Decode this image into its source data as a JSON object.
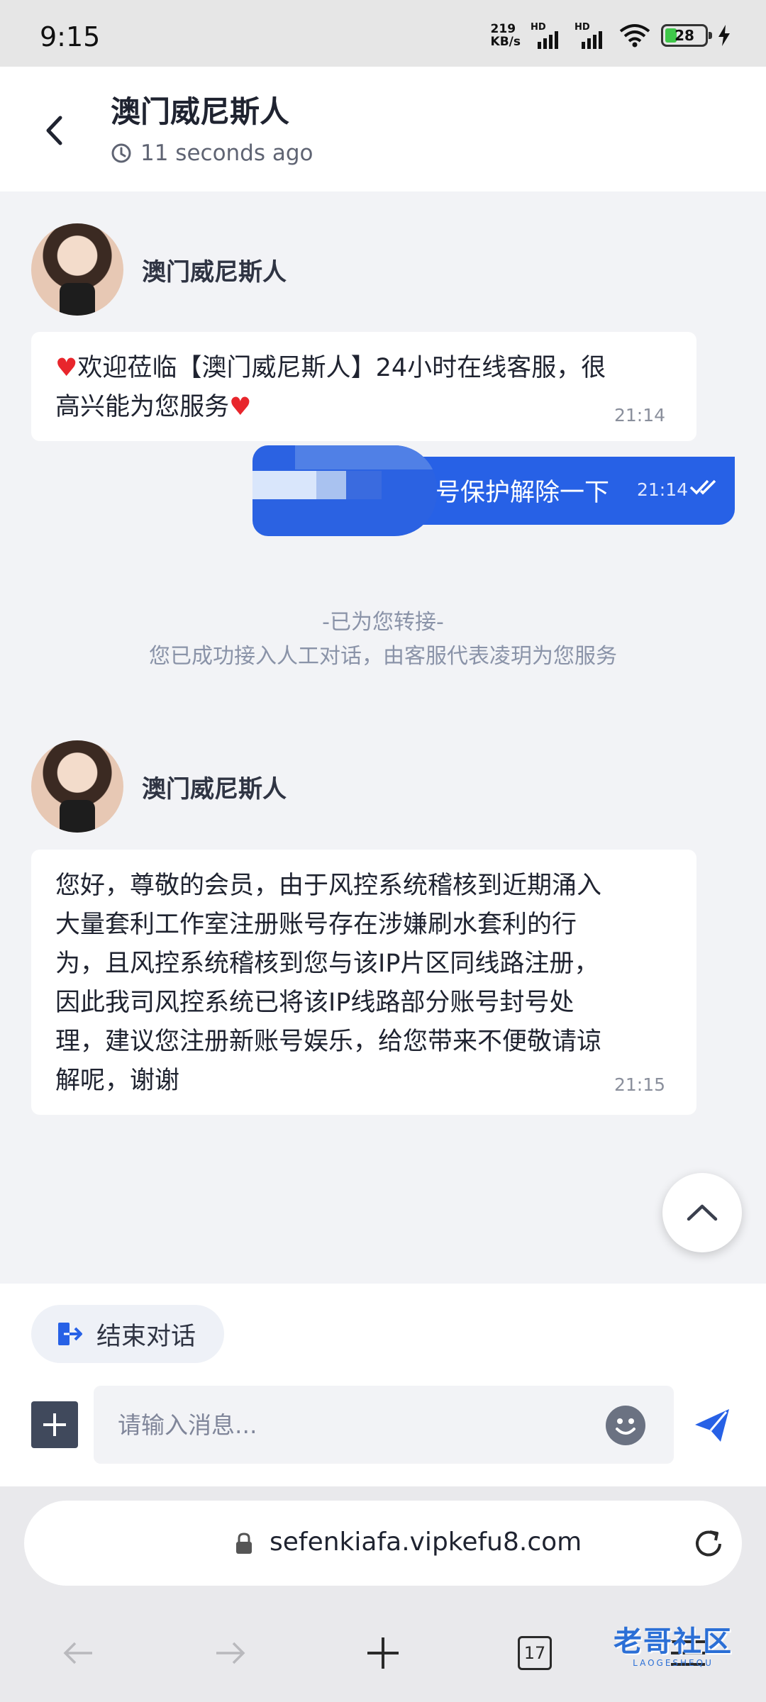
{
  "status_bar": {
    "time": "9:15",
    "net_speed_value": "219",
    "net_speed_unit": "KB/s",
    "sim1_label": "HD",
    "sim2_label": "HD",
    "battery": "28"
  },
  "header": {
    "title": "澳门威尼斯人",
    "last_seen": "11 seconds ago"
  },
  "messages": {
    "agent_name_1": "澳门威尼斯人",
    "welcome_text": "♥欢迎莅临【澳门威尼斯人】24小时在线客服，很高兴能为您服务♥",
    "welcome_time": "21:14",
    "user_text": "号保护解除一下",
    "user_time": "21:14",
    "system_line1": "-已为您转接-",
    "system_line2": "您已成功接入人工对话，由客服代表凌玥为您服务",
    "agent_name_2": "澳门威尼斯人",
    "reply_text": "您好，尊敬的会员，由于风控系统稽核到近期涌入大量套利工作室注册账号存在涉嫌刷水套利的行为，且风控系统稽核到您与该IP片区同线路注册，因此我司风控系统已将该IP线路部分账号封号处理，建议您注册新账号娱乐，给您带来不便敬请谅解呢，谢谢",
    "reply_time": "21:15"
  },
  "composer": {
    "end_chat_label": "结束对话",
    "input_placeholder": "请输入消息..."
  },
  "browser": {
    "url": "sefenkiafa.vipkefu8.com",
    "tab_count": "17"
  },
  "watermark": {
    "title": "老哥社区",
    "subtitle": "LAOGESHEQU"
  },
  "colors": {
    "accent": "#2761e6",
    "heart": "#e8262c"
  }
}
